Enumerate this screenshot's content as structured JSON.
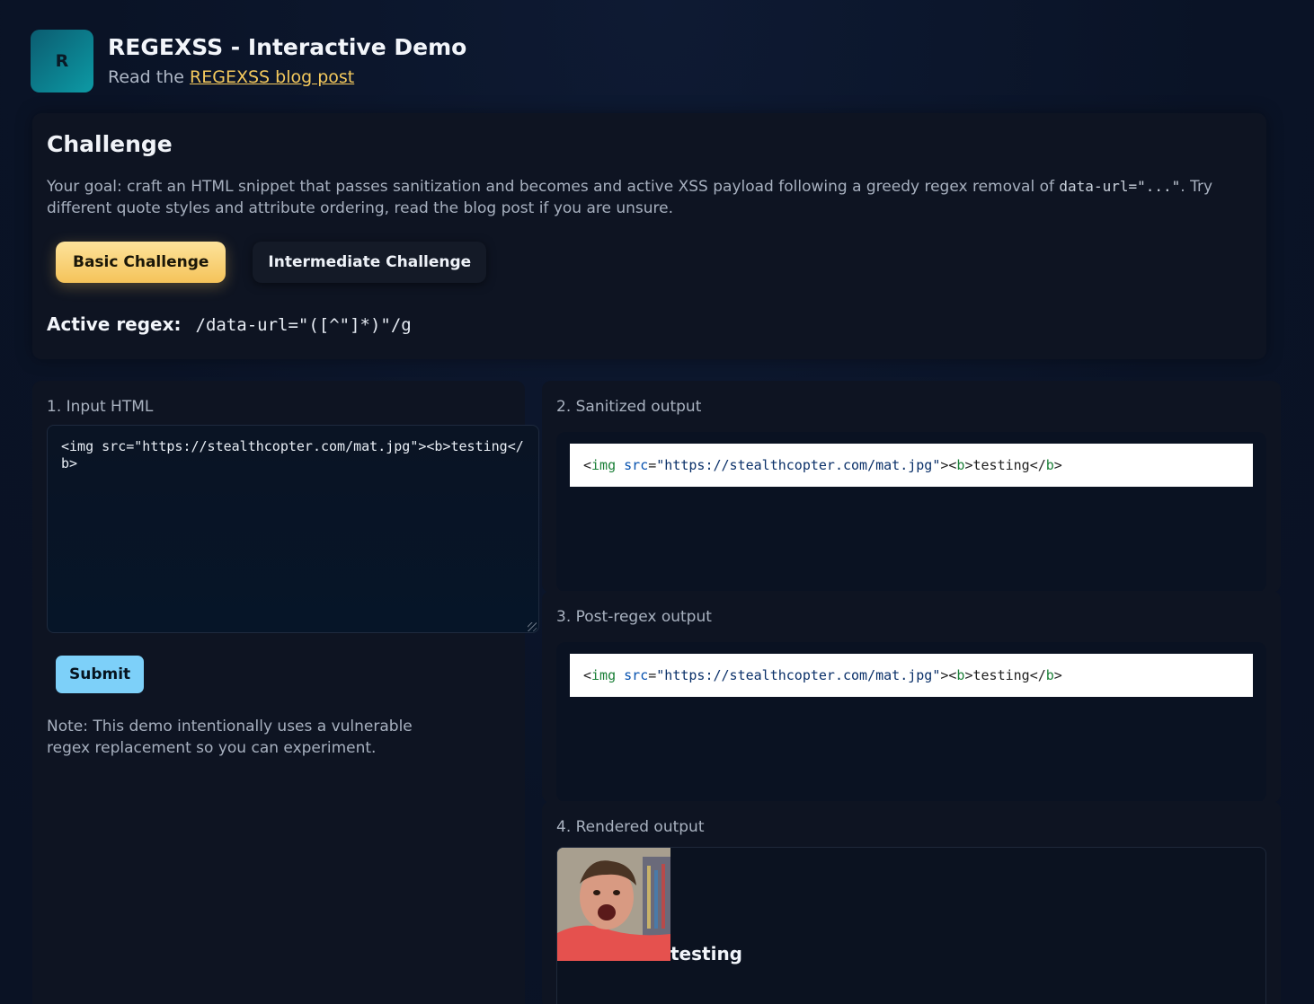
{
  "header": {
    "logo_letter": "R",
    "title": "REGEXSS - Interactive Demo",
    "subtitle_prefix": "Read the ",
    "blog_link": "REGEXSS blog post"
  },
  "challenge": {
    "heading": "Challenge",
    "desc_part1": "Your goal: craft an HTML snippet that passes sanitization and becomes and active XSS payload following a greedy regex removal of ",
    "desc_code": "data-url=\"...\"",
    "desc_part2": ". Try different quote styles and attribute ordering, read the blog post if you are unsure.",
    "basic_label": "Basic Challenge",
    "intermediate_label": "Intermediate Challenge",
    "regex_label": "Active regex:",
    "regex_value": "/data-url=\"([^\"]*)\"/g"
  },
  "input": {
    "label": "1. Input HTML",
    "value": "<img src=\"https://stealthcopter.com/mat.jpg\"><b>testing</b>",
    "submit_label": "Submit",
    "note": "Note: This demo intentionally uses a vulnerable regex replacement so you can experiment."
  },
  "outputs": {
    "sanitized_label": "2. Sanitized output",
    "post_regex_label": "3. Post-regex output",
    "rendered_label": "4. Rendered output",
    "code": {
      "open": "<",
      "img": "img",
      "src_attr": "src",
      "eq": "=",
      "src_val": "\"https://stealthcopter.com/mat.jpg\"",
      "gt_lt": "><",
      "b": "b",
      "text_between": ">testing</",
      "close": ">"
    },
    "rendered_text": "testing"
  },
  "colors": {
    "accent_yellow": "#f5c35a",
    "accent_blue": "#7dd0f9",
    "background": "#0b1426"
  }
}
